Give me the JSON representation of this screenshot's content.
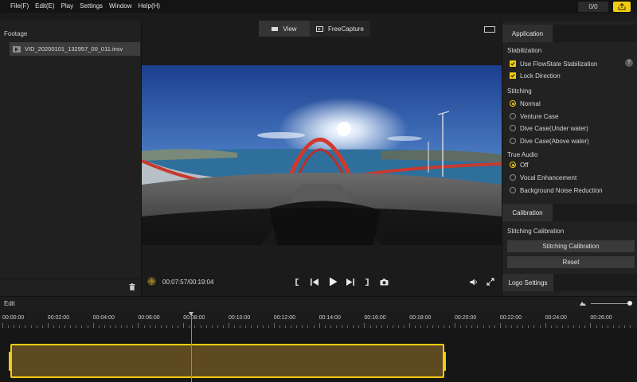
{
  "menu": [
    "File(F)",
    "Edit(E)",
    "Play",
    "Settings",
    "Window",
    "Help(H)"
  ],
  "counter": "0/0",
  "footage": {
    "title": "Footage",
    "file": "VID_20200101_132957_00_011.insv"
  },
  "viewer": {
    "tabs": [
      "View",
      "FreeCapture"
    ],
    "active_tab": "View",
    "time": "00:07:57/00:19:04"
  },
  "panel": {
    "tab_application": "Application",
    "stabilization": {
      "title": "Stabilization",
      "options": [
        {
          "label": "Use FlowState Stabilization",
          "checked": true
        },
        {
          "label": "Lock Direction",
          "checked": true
        }
      ],
      "help": "?"
    },
    "stitching": {
      "title": "Stitching",
      "options": [
        "Normal",
        "Venture Case",
        "Dive Case(Under water)",
        "Dive Case(Above water)"
      ],
      "selected": "Normal"
    },
    "true_audio": {
      "title": "True Audio",
      "options": [
        "Off",
        "Vocal Enhancement",
        "Background Noise Reduction"
      ],
      "selected": "Off"
    },
    "tab_calibration": "Calibration",
    "calibration": {
      "title": "Stitching Calibration",
      "button": "Stitching Calibration",
      "reset": "Reset"
    },
    "tab_logo": "Logo Settings"
  },
  "timeline": {
    "label": "Edit",
    "ticks": [
      "00:00:00",
      "00:02:00",
      "00:04:00",
      "00:06:00",
      "00:08:00",
      "00:10:00",
      "00:12:00",
      "00:14:00",
      "00:16:00",
      "00:18:00",
      "00:20:00",
      "00:22:00",
      "00:24:00",
      "00:26:00"
    ]
  },
  "colors": {
    "accent": "#f2cc12",
    "clip_fill": "#5d4a21",
    "background": "#1b1b1b"
  },
  "icons": [
    "play-icon",
    "prev-frame-icon",
    "next-frame-icon",
    "mark-in-icon",
    "mark-out-icon",
    "snapshot-icon",
    "volume-icon",
    "fullscreen-icon",
    "trash-icon",
    "export-icon"
  ]
}
